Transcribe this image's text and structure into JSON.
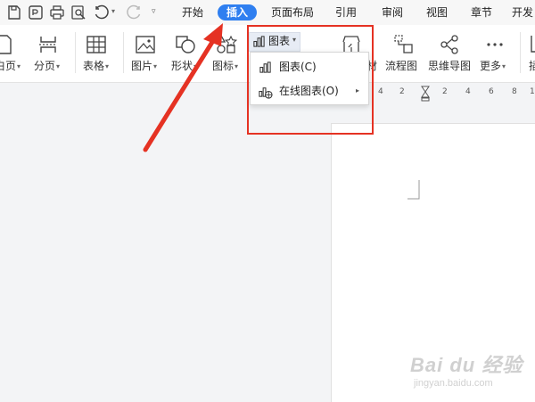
{
  "tabs": [
    {
      "label": "开始",
      "active": false
    },
    {
      "label": "插入",
      "active": true
    },
    {
      "label": "页面布局",
      "active": false
    },
    {
      "label": "引用",
      "active": false
    },
    {
      "label": "审阅",
      "active": false
    },
    {
      "label": "视图",
      "active": false
    },
    {
      "label": "章节",
      "active": false
    },
    {
      "label": "开发",
      "active": false
    }
  ],
  "ribbon": {
    "page_label": "白页",
    "split_label": "分页",
    "table_label": "表格",
    "picture_label": "图片",
    "shape_label": "形状",
    "icon_label": "图标",
    "chart_label": "图表",
    "resource_label": "材",
    "flowchart_label": "流程图",
    "mindmap_label": "思维导图",
    "more_label": "更多",
    "cut_label": "插"
  },
  "dropdown": {
    "items": [
      {
        "label": "图表(C)"
      },
      {
        "label": "在线图表(O)"
      }
    ]
  },
  "ruler": {
    "ticks": [
      "4",
      "2",
      "2",
      "4",
      "6",
      "8",
      "1"
    ]
  },
  "watermark": {
    "brand": "Bai du 经验",
    "url": "jingyan.baidu.com"
  },
  "colors": {
    "accent": "#2f7ff0",
    "highlight": "#e53223",
    "arrow": "#e53223"
  }
}
